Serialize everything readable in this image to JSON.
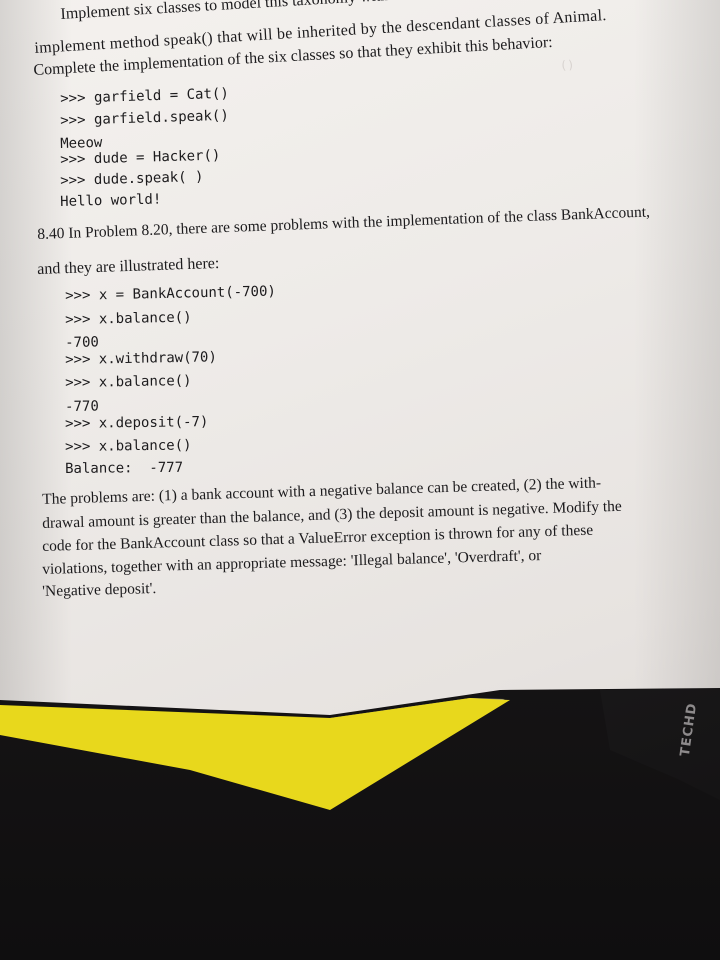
{
  "problem_prev": {
    "intro_lines": [
      "Implement six classes to model this taxonomy with ",
      "implement method speak() that will be inherited by the descendant classes of Animal.",
      "Complete the implementation of the six classes so that they exhibit this behavior:"
    ],
    "code_lines": [
      ">>> garfield = Cat()",
      ">>> garfield.speak()",
      "Meeow",
      ">>> dude = Hacker()",
      ">>> dude.speak( )",
      "Hello world!"
    ]
  },
  "problem_840": {
    "number": "8.40",
    "intro_lines": [
      "In Problem 8.20, there are some problems with the implementation of the class BankAccount,",
      "and they are illustrated here:"
    ],
    "code_lines": [
      ">>> x = BankAccount(-700)",
      ">>> x.balance()",
      "-700",
      ">>> x.withdraw(70)",
      ">>> x.balance()",
      "-770",
      ">>> x.deposit(-7)",
      ">>> x.balance()",
      "Balance:  -777"
    ],
    "description_lines": [
      "The problems are: (1) a bank account with a negative balance can be created, (2) the with-",
      "drawal amount is greater than the balance, and (3) the deposit amount is negative. Modify the",
      "code for the BankAccount class so that a ValueError exception is thrown for any of these",
      "violations, together with an appropriate message: 'Illegal balance', 'Overdraft', or",
      "'Negative deposit'."
    ]
  },
  "device_label": "TECHD",
  "colors": {
    "paper": "#efece9",
    "ink": "#1c1b1d",
    "yellow": "#e8d81c",
    "desk": "#1c1a1b"
  }
}
